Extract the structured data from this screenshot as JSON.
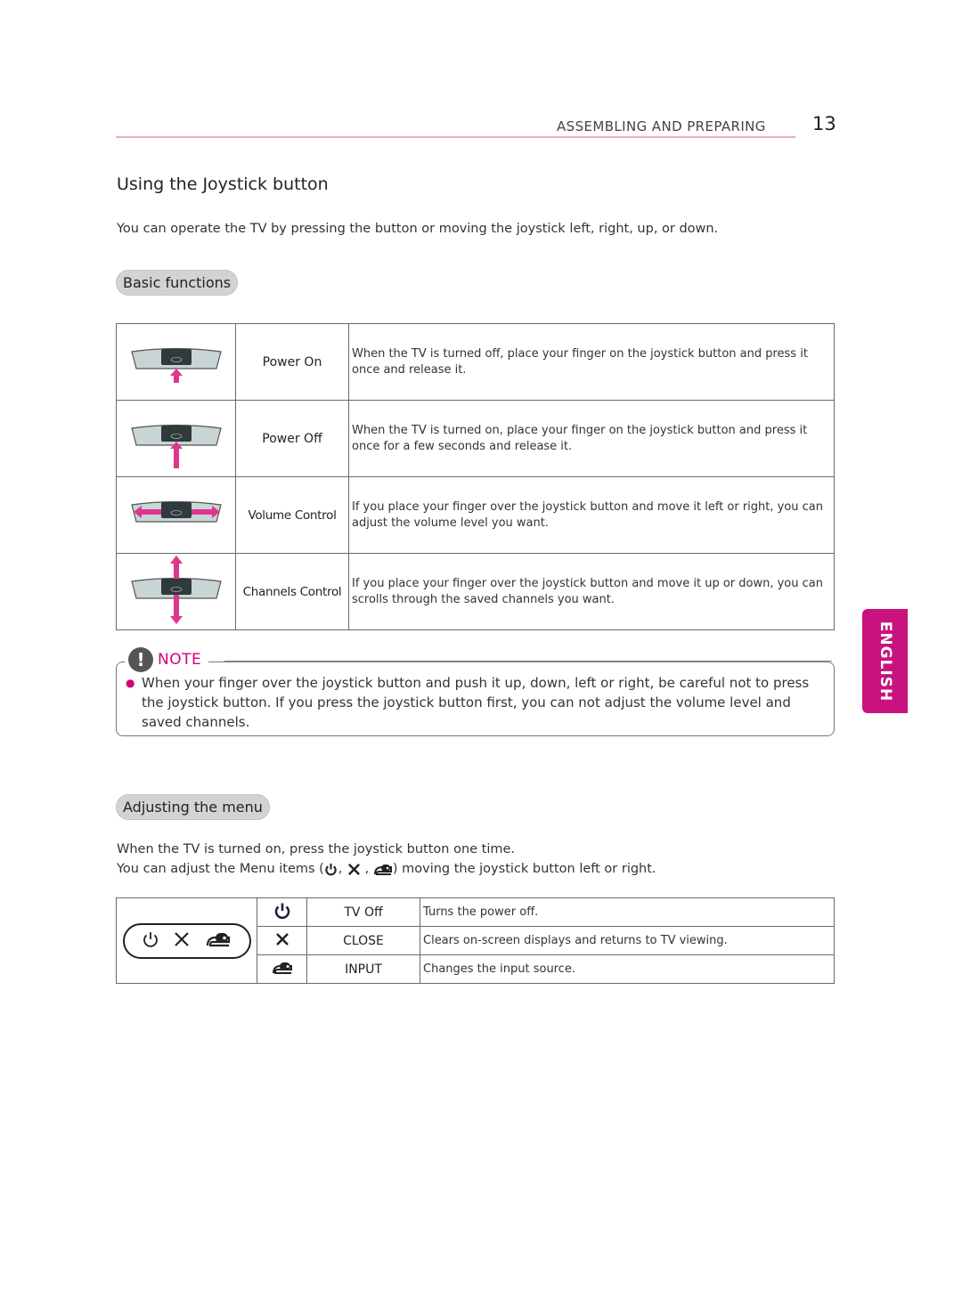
{
  "header": {
    "section": "ASSEMBLING AND PREPARING",
    "page_number": "13",
    "accent_color": "#f2a6c8"
  },
  "title": "Using the Joystick button",
  "intro": "You can operate the TV by pressing the button or moving the joystick left, right, up, or down.",
  "basic_functions": {
    "heading": "Basic functions",
    "rows": [
      {
        "icon": "joystick-press-up-icon",
        "label": "Power On",
        "description": "When the TV is turned off, place your finger on the joystick button and press it once and release it."
      },
      {
        "icon": "joystick-press-long-icon",
        "label": "Power Off",
        "description": "When the TV is turned on, place your finger on the joystick button and press it once for a few seconds and release it."
      },
      {
        "icon": "joystick-left-right-icon",
        "label": "Volume Control",
        "description": "If you place your finger over the joystick button and move it left or right, you can adjust the volume level you want."
      },
      {
        "icon": "joystick-up-down-icon",
        "label": "Channels Control",
        "description": "If you place your finger over the joystick button and move it up or down, you can scrolls through the saved channels you want."
      }
    ]
  },
  "note": {
    "label": "NOTE",
    "text": "When your finger over the joystick button and push it up, down, left or right, be careful not to press the joystick button. If you press the joystick button first, you can not adjust the volume level and saved channels.",
    "accent_color": "#d3007a"
  },
  "language_tab": {
    "label": "ENGLISH",
    "color": "#c8137e"
  },
  "adjusting_menu": {
    "heading": "Adjusting the menu",
    "line1": "When the TV is turned on, press the joystick button one time.",
    "line2_prefix": "You can adjust the Menu items (",
    "line2_sep1": ", ",
    "line2_sep2": " , ",
    "line2_suffix": ") moving the joystick button left or right.",
    "rows": [
      {
        "icon": "power-icon",
        "name": "TV Off",
        "description": "Turns the power off."
      },
      {
        "icon": "close-icon",
        "name": "CLOSE",
        "description": "Clears on-screen displays and returns to TV viewing."
      },
      {
        "icon": "input-icon",
        "name": "INPUT",
        "description": "Changes the input source."
      }
    ]
  }
}
